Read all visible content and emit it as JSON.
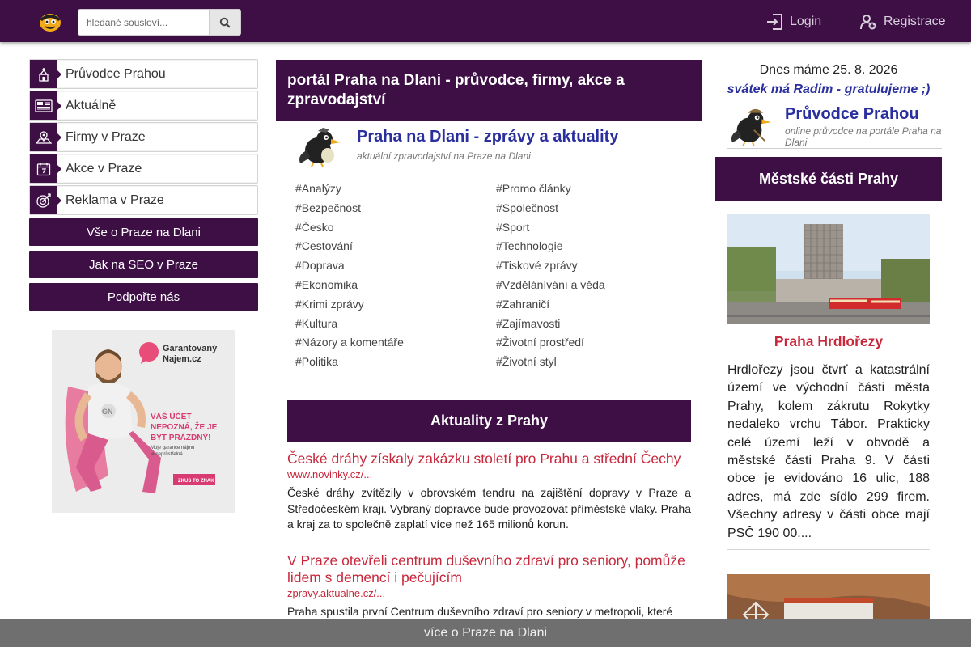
{
  "header": {
    "search_placeholder": "hledané sousloví...",
    "login_label": "Login",
    "register_label": "Registrace"
  },
  "sidebar": {
    "menu": [
      {
        "label": "Průvodce Prahou",
        "icon": "church-icon"
      },
      {
        "label": "Aktuálně",
        "icon": "newspaper-icon"
      },
      {
        "label": "Firmy v Praze",
        "icon": "map-pin-icon"
      },
      {
        "label": "Akce v Praze",
        "icon": "calendar-icon"
      },
      {
        "label": "Reklama v Praze",
        "icon": "target-icon"
      }
    ],
    "buttons": [
      "Vše o Praze na Dlani",
      "Jak na SEO v Praze",
      "Podpořte nás"
    ],
    "ad": {
      "brand_line1": "Garantovaný",
      "brand_line2": "Najem.cz",
      "slogan_line1": "VÁŠ ÚČET",
      "slogan_line2": "NEPOZNÁ, ŽE JE",
      "slogan_line3": "BYT PRÁZDNÝ!",
      "small_line1": "Moje garance nájmu",
      "small_line2": "je neprůstřelná",
      "cta": "ZKUS TO ZNAK"
    }
  },
  "main": {
    "portal_title": "portál Praha na Dlani - průvodce, firmy, akce a zpravodajství",
    "news_title": "Praha na Dlani - zprávy a aktuality",
    "news_subtitle": "aktuální zpravodajství na Praze na Dlani",
    "tags": [
      "Analýzy",
      "Promo články",
      "Bezpečnost",
      "Společnost",
      "Česko",
      "Sport",
      "Cestování",
      "Technologie",
      "Doprava",
      "Tiskové zprávy",
      "Ekonomika",
      "Vzdělánívání a věda",
      "Krimi zprávy",
      "Zahraničí",
      "Kultura",
      "Zajímavosti",
      "Názory a komentáře",
      "Životní prostředí",
      "Politika",
      "Životní styl"
    ],
    "aktuality_heading": "Aktuality z Prahy",
    "articles": [
      {
        "title": "České dráhy získaly zakázku století pro Prahu a střední Čechy",
        "source": "www.novinky.cz/...",
        "text": "České dráhy zvítězily v obrovském tendru na zajištění dopravy v Praze a Středočeském kraji. Vybraný dopravce bude provozovat příměstské vlaky. Praha a kraj za to společně zaplatí více než 165 milionů korun."
      },
      {
        "title": "V Praze otevřeli centrum duševního zdraví pro seniory, pomůže lidem s demencí i pečujícím",
        "source": "zpravy.aktualne.cz/...",
        "text": "Praha spustila první Centrum duševního zdraví pro seniory v metropoli, které"
      }
    ]
  },
  "right": {
    "date_text": "Dnes máme 25. 8. 2026",
    "nameday_text": "svátek má Radim - gratulujeme ;)",
    "guide_title": "Průvodce Prahou",
    "guide_subtitle": "online průvodce na portále Praha na Dlani",
    "districts_heading": "Městské části Prahy",
    "district_name": "Praha Hrdlořezy",
    "district_text": "Hrdlořezy jsou čtvrť a katastrální území ve východní části města Prahy, kolem zákrutu Rokytky nedaleko vrchu Tábor. Prakticky celé území leží v obvodě a městské části Praha 9. V části obce je evidováno 16 ulic, 188 adres, má zde sídlo 299 firem. Všechny adresy v části obce mají PSČ 190 00...."
  },
  "footer": {
    "label": "více o Praze na Dlani"
  },
  "colors": {
    "brand_purple": "#3d0f45",
    "link_blue": "#2a2f9e",
    "accent_red": "#c8283c",
    "footer_gray": "#6f6f6f"
  }
}
